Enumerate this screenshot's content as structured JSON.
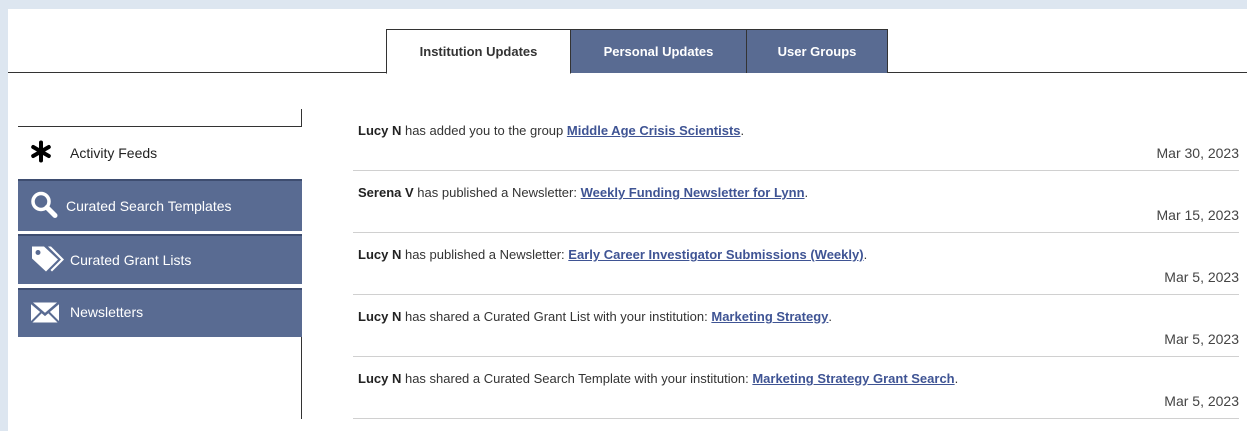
{
  "tabs": [
    {
      "label": "Institution Updates",
      "active": true
    },
    {
      "label": "Personal Updates",
      "active": false
    },
    {
      "label": "User Groups",
      "active": false
    }
  ],
  "sidebar": {
    "items": [
      {
        "label": "Activity Feeds",
        "icon": "asterisk-icon",
        "active": true
      },
      {
        "label": "Curated Search Templates",
        "icon": "search-icon",
        "active": false
      },
      {
        "label": "Curated Grant Lists",
        "icon": "tags-icon",
        "active": false
      },
      {
        "label": "Newsletters",
        "icon": "envelope-icon",
        "active": false
      }
    ]
  },
  "feed": [
    {
      "actor": "Lucy N",
      "text": "has added you to the group",
      "link": "Middle Age Crisis Scientists",
      "suffix": ".",
      "date": "Mar 30, 2023"
    },
    {
      "actor": "Serena V",
      "text": "has published a Newsletter:",
      "link": "Weekly Funding Newsletter for Lynn",
      "suffix": ".",
      "date": "Mar 15, 2023"
    },
    {
      "actor": "Lucy N",
      "text": "has published a Newsletter:",
      "link": "Early Career Investigator Submissions (Weekly)",
      "suffix": ".",
      "date": "Mar 5, 2023"
    },
    {
      "actor": "Lucy N",
      "text": "has shared a Curated Grant List with your institution:",
      "link": "Marketing Strategy",
      "suffix": ".",
      "date": "Mar 5, 2023"
    },
    {
      "actor": "Lucy N",
      "text": "has shared a Curated Search Template with your institution:",
      "link": "Marketing Strategy Grant Search",
      "suffix": ".",
      "date": "Mar 5, 2023"
    }
  ],
  "colors": {
    "nav_bg": "#596b92",
    "link": "#3f5494",
    "page_bg": "#dde6f0"
  }
}
